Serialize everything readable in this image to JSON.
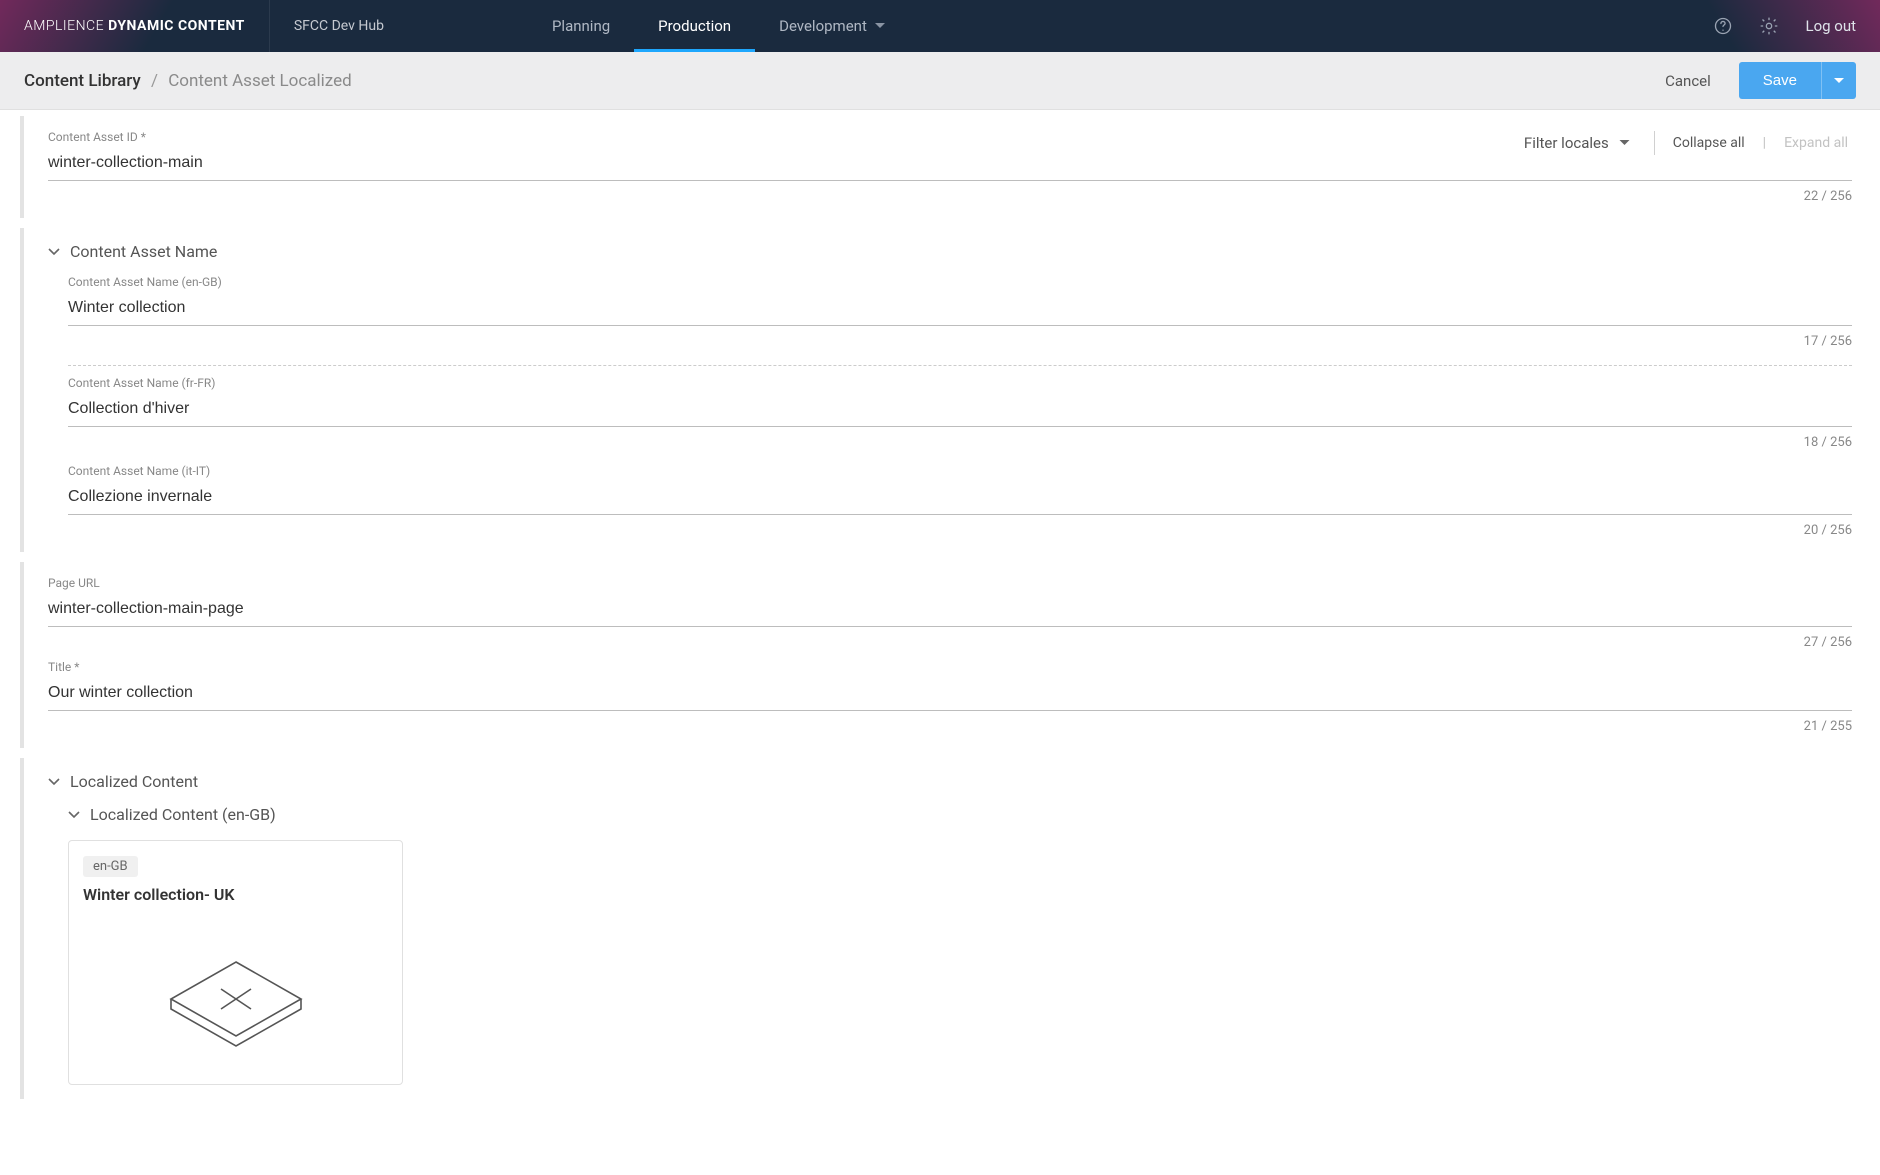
{
  "brand": {
    "light_part": "AMPLIENCE",
    "bold_part": "DYNAMIC CONTENT"
  },
  "hub_name": "SFCC Dev Hub",
  "nav": {
    "planning": "Planning",
    "production": "Production",
    "development": "Development"
  },
  "logout": "Log out",
  "breadcrumb": {
    "root": "Content Library",
    "leaf": "Content Asset Localized",
    "sep": "/"
  },
  "actions": {
    "cancel": "Cancel",
    "save": "Save"
  },
  "locale_toolbar": {
    "filter": "Filter locales",
    "collapse_all": "Collapse all",
    "expand_all": "Expand all"
  },
  "fields": {
    "asset_id": {
      "label": "Content Asset ID *",
      "value": "winter-collection-main",
      "counter": "22 / 256"
    },
    "asset_name_section": "Content Asset Name",
    "name_en": {
      "label": "Content Asset Name (en-GB)",
      "value": "Winter collection",
      "counter": "17 / 256"
    },
    "name_fr": {
      "label": "Content Asset Name (fr-FR)",
      "value": "Collection d'hiver",
      "counter": "18 / 256"
    },
    "name_it": {
      "label": "Content Asset Name (it-IT)",
      "value": "Collezione invernale",
      "counter": "20 / 256"
    },
    "page_url": {
      "label": "Page URL",
      "value": "winter-collection-main-page",
      "counter": "27 / 256"
    },
    "title": {
      "label": "Title *",
      "value": "Our winter collection",
      "counter": "21 / 255"
    },
    "localized_content_section": "Localized Content",
    "localized_content_en_section": "Localized Content (en-GB)",
    "card_en": {
      "badge": "en-GB",
      "title": "Winter collection- UK"
    }
  }
}
